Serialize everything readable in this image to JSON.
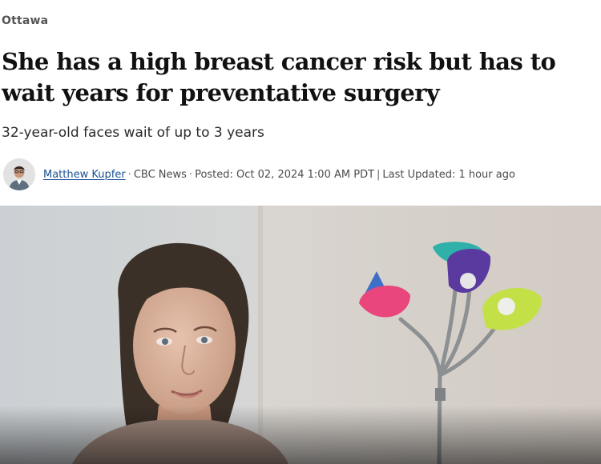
{
  "section": {
    "label": "Ottawa"
  },
  "article": {
    "headline": "She has a high breast cancer risk but has to wait years for preventative surgery",
    "subheadline": "32-year-old faces wait of up to 3 years"
  },
  "byline": {
    "author": "Matthew Kupfer",
    "sep1": "·",
    "outlet": "CBC News",
    "sep2": "·",
    "posted": "Posted: Oct 02, 2024 1:00 AM PDT",
    "sep3": "|",
    "updated": "Last Updated: 1 hour ago"
  },
  "colors": {
    "link": "#1b4f93",
    "section_label": "#555555"
  },
  "icons": {
    "author_avatar": "author-avatar-icon"
  }
}
